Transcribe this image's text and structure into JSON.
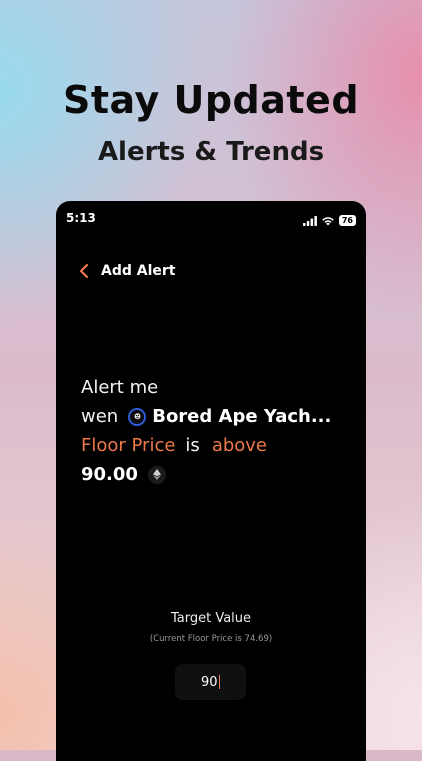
{
  "promo": {
    "headline": "Stay Updated",
    "subheadline": "Alerts & Trends"
  },
  "status_bar": {
    "time": "5:13",
    "battery": "76"
  },
  "nav": {
    "title": "Add Alert"
  },
  "alert": {
    "line1": "Alert me",
    "prefix": "wen",
    "collection": "Bored Ape Yach...",
    "metric": "Floor Price",
    "connector": "is",
    "condition": "above",
    "value": "90.00"
  },
  "target": {
    "label": "Target Value",
    "hint": "(Current Floor Price is 74.69)",
    "value": "90"
  },
  "colors": {
    "accent": "#ee7a4c",
    "background": "#000000",
    "logo_ring": "#2e5bd8"
  },
  "icons": {
    "back": "chevron-left-icon",
    "eth": "ethereum-icon",
    "signal": "cellular-signal-icon",
    "wifi": "wifi-icon",
    "battery": "battery-icon"
  }
}
